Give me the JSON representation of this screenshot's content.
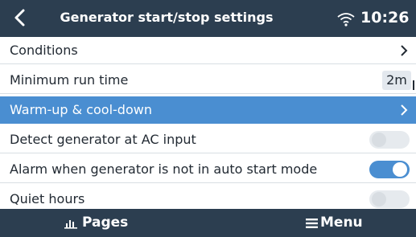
{
  "header": {
    "title": "Generator start/stop settings",
    "time": "10:26",
    "back_icon": "chevron-left-icon",
    "wifi_icon": "wifi-icon"
  },
  "rows": [
    {
      "label": "Conditions",
      "control": "chevron"
    },
    {
      "label": "Minimum run time",
      "control": "value",
      "value": "2m"
    },
    {
      "label": "Warm-up & cool-down",
      "control": "chevron",
      "selected": true
    },
    {
      "label": "Detect generator at AC input",
      "control": "toggle",
      "state": "off"
    },
    {
      "label": "Alarm when generator is not in auto start mode",
      "control": "toggle",
      "state": "on"
    },
    {
      "label": "Quiet hours",
      "control": "toggle",
      "state": "off"
    }
  ],
  "footer": {
    "pages_label": "Pages",
    "menu_label": "Menu",
    "pages_icon": "bar-chart-icon",
    "menu_icon": "hamburger-icon"
  },
  "colors": {
    "header_bg": "#2c3e50",
    "selected_bg": "#4a8ed1",
    "toggle_on": "#4a8ed1",
    "toggle_off": "#e6eaee"
  }
}
